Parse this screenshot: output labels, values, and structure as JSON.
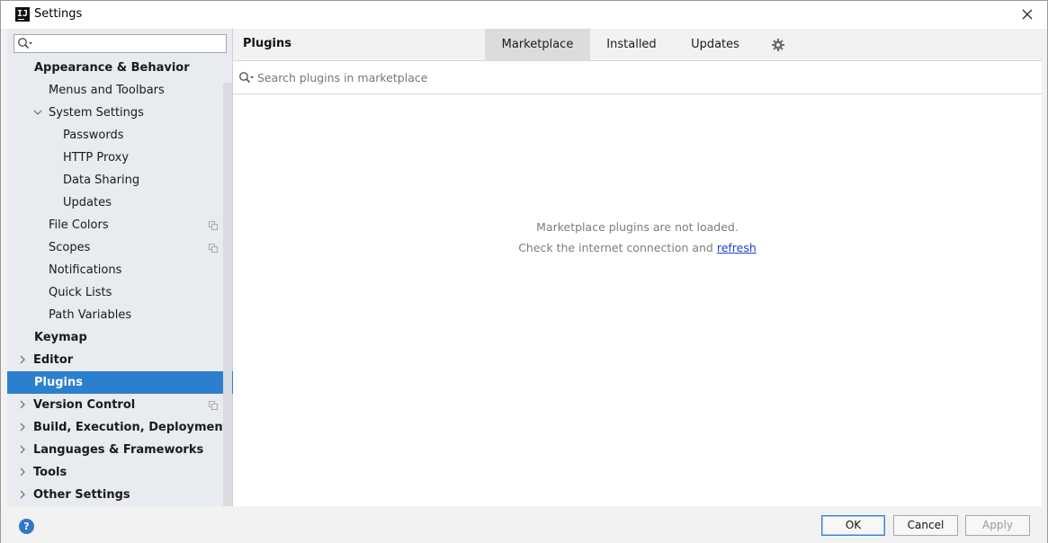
{
  "window": {
    "title": "Settings",
    "app_icon_letter": "IJ"
  },
  "sidebar": {
    "search_value": "",
    "items": [
      {
        "label": "Appearance & Behavior",
        "bold": true,
        "indent": 0,
        "arrow": "none"
      },
      {
        "label": "Menus and Toolbars",
        "bold": false,
        "indent": 1,
        "arrow": "none"
      },
      {
        "label": "System Settings",
        "bold": false,
        "indent": 1,
        "arrow": "down"
      },
      {
        "label": "Passwords",
        "bold": false,
        "indent": 2,
        "arrow": "none"
      },
      {
        "label": "HTTP Proxy",
        "bold": false,
        "indent": 2,
        "arrow": "none"
      },
      {
        "label": "Data Sharing",
        "bold": false,
        "indent": 2,
        "arrow": "none"
      },
      {
        "label": "Updates",
        "bold": false,
        "indent": 2,
        "arrow": "none"
      },
      {
        "label": "File Colors",
        "bold": false,
        "indent": 1,
        "arrow": "none",
        "copy_icon": true
      },
      {
        "label": "Scopes",
        "bold": false,
        "indent": 1,
        "arrow": "none",
        "copy_icon": true
      },
      {
        "label": "Notifications",
        "bold": false,
        "indent": 1,
        "arrow": "none"
      },
      {
        "label": "Quick Lists",
        "bold": false,
        "indent": 1,
        "arrow": "none"
      },
      {
        "label": "Path Variables",
        "bold": false,
        "indent": 1,
        "arrow": "none"
      },
      {
        "label": "Keymap",
        "bold": true,
        "indent": 0,
        "arrow": "none"
      },
      {
        "label": "Editor",
        "bold": true,
        "indent": 0,
        "arrow": "right"
      },
      {
        "label": "Plugins",
        "bold": true,
        "indent": 0,
        "arrow": "none",
        "selected": true
      },
      {
        "label": "Version Control",
        "bold": true,
        "indent": 0,
        "arrow": "right",
        "copy_icon": true
      },
      {
        "label": "Build, Execution, Deployment",
        "bold": true,
        "indent": 0,
        "arrow": "right"
      },
      {
        "label": "Languages & Frameworks",
        "bold": true,
        "indent": 0,
        "arrow": "right"
      },
      {
        "label": "Tools",
        "bold": true,
        "indent": 0,
        "arrow": "right"
      },
      {
        "label": "Other Settings",
        "bold": true,
        "indent": 0,
        "arrow": "right"
      }
    ]
  },
  "main": {
    "title": "Plugins",
    "tabs": [
      {
        "label": "Marketplace",
        "active": true
      },
      {
        "label": "Installed",
        "active": false
      },
      {
        "label": "Updates",
        "active": false
      }
    ],
    "search": {
      "placeholder": "Search plugins in marketplace",
      "value": ""
    },
    "message_line1": "Marketplace plugins are not loaded.",
    "message_line2_prefix": "Check the internet connection and ",
    "message_link": "refresh"
  },
  "buttons": {
    "help": "?",
    "ok": "OK",
    "cancel": "Cancel",
    "apply": "Apply"
  },
  "colors": {
    "selection": "#2b7fce",
    "link": "#2040c8",
    "help": "#2f77c9"
  }
}
